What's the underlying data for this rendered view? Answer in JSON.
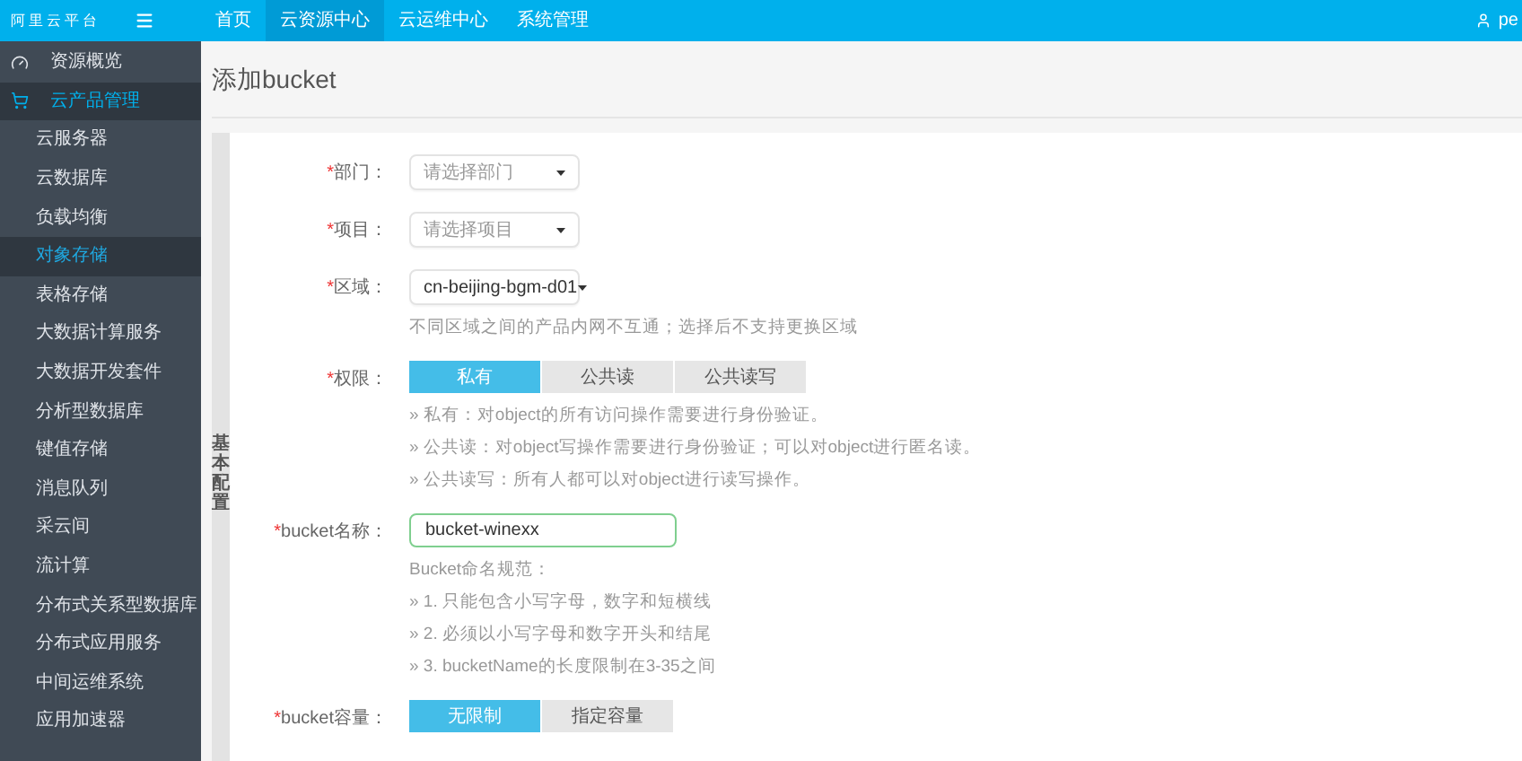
{
  "logo": "阿里云平台",
  "nav": [
    {
      "label": "首页",
      "selected": false
    },
    {
      "label": "云资源中心",
      "selected": true
    },
    {
      "label": "云运维中心",
      "selected": false
    },
    {
      "label": "系统管理",
      "selected": false
    }
  ],
  "user": {
    "name": "pe"
  },
  "sidebar": {
    "items": [
      {
        "label": "资源概览",
        "kind": "overview",
        "selected": false
      },
      {
        "label": "云产品管理",
        "kind": "products",
        "selected": true
      },
      {
        "label": "云服务器",
        "kind": "sub",
        "selected": false
      },
      {
        "label": "云数据库",
        "kind": "sub",
        "selected": false
      },
      {
        "label": "负载均衡",
        "kind": "sub",
        "selected": false
      },
      {
        "label": "对象存储",
        "kind": "sub",
        "selected": true
      },
      {
        "label": "表格存储",
        "kind": "sub",
        "selected": false
      },
      {
        "label": "大数据计算服务",
        "kind": "sub",
        "selected": false
      },
      {
        "label": "大数据开发套件",
        "kind": "sub",
        "selected": false
      },
      {
        "label": "分析型数据库",
        "kind": "sub",
        "selected": false
      },
      {
        "label": "键值存储",
        "kind": "sub",
        "selected": false
      },
      {
        "label": "消息队列",
        "kind": "sub",
        "selected": false
      },
      {
        "label": "采云间",
        "kind": "sub",
        "selected": false
      },
      {
        "label": "流计算",
        "kind": "sub",
        "selected": false
      },
      {
        "label": "分布式关系型数据库",
        "kind": "sub",
        "selected": false
      },
      {
        "label": "分布式应用服务",
        "kind": "sub",
        "selected": false
      },
      {
        "label": "中间运维系统",
        "kind": "sub",
        "selected": false
      },
      {
        "label": "应用加速器",
        "kind": "sub",
        "selected": false
      }
    ]
  },
  "page_title": "添加bucket",
  "section_label": "基本配置",
  "form": [
    {
      "kind": "select",
      "mark": "*",
      "label": "部门：",
      "placeholder": "请选择部门"
    },
    {
      "kind": "select",
      "mark": "*",
      "label": "项目：",
      "placeholder": "请选择项目"
    },
    {
      "kind": "select",
      "mark": "*",
      "label": "区域：",
      "value": "cn-beijing-bgm-d01",
      "notes": [
        "不同区域之间的产品内网不互通；选择后不支持更换区域"
      ]
    },
    {
      "kind": "segmented",
      "mark": "*",
      "label": "权限：",
      "options": [
        {
          "label": "私有",
          "selected": true
        },
        {
          "label": "公共读",
          "selected": false
        },
        {
          "label": "公共读写",
          "selected": false
        }
      ],
      "notes": [
        "» 私有：对object的所有访问操作需要进行身份验证。",
        "» 公共读：对object写操作需要进行身份验证；可以对object进行匿名读。",
        "» 公共读写：所有人都可以对object进行读写操作。"
      ]
    },
    {
      "kind": "text",
      "mark": "*",
      "label": "bucket名称：",
      "value": "bucket-winexx",
      "notes": [
        "Bucket命名规范：",
        "» 1. 只能包含小写字母，数字和短横线",
        "» 2. 必须以小写字母和数字开头和结尾",
        "» 3. bucketName的长度限制在3-35之间"
      ]
    },
    {
      "kind": "segmented",
      "mark": "*",
      "label": "bucket容量：",
      "options": [
        {
          "label": "无限制",
          "selected": true
        },
        {
          "label": "指定容量",
          "selected": false
        }
      ]
    }
  ]
}
